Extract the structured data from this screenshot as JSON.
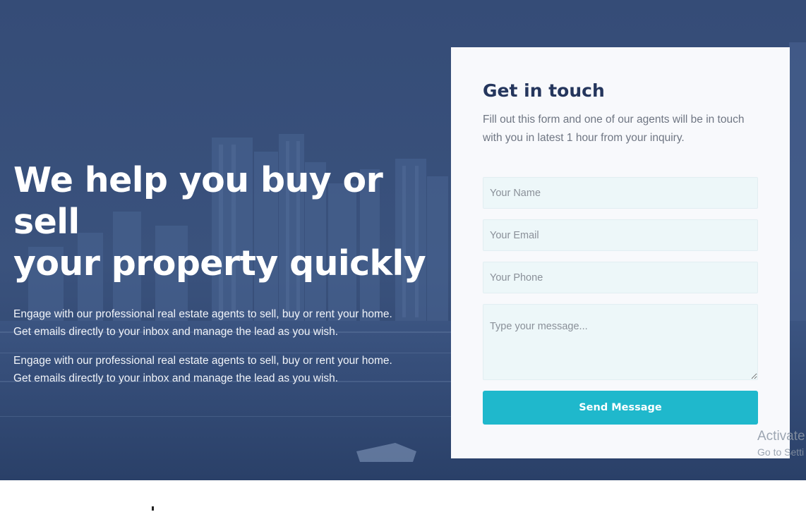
{
  "hero": {
    "title_line1": "We help you buy or sell",
    "title_line2": "your property quickly",
    "paragraph1": "Engage with our professional real estate agents to sell, buy or rent your home.  Get emails directly to your inbox and manage the lead as you wish.",
    "paragraph2": "Engage with our professional real estate agents to sell, buy or rent your home.  Get emails directly to your inbox and manage the lead as you wish."
  },
  "contact_form": {
    "title": "Get in touch",
    "subtitle": "Fill out this form and one of our agents will be in touch with you in latest 1 hour from your inquiry.",
    "name_placeholder": "Your Name",
    "email_placeholder": "Your Email",
    "phone_placeholder": "Your Phone",
    "message_placeholder": "Type your message...",
    "submit_label": "Send Message"
  },
  "windows_watermark": {
    "line1": "Activate",
    "line2": "Go to Setti"
  },
  "colors": {
    "overlay": "#2e4670",
    "card_background": "#f8f9fc",
    "heading": "#25365d",
    "field_background": "#edf7f9",
    "button": "#1fb8cc"
  }
}
